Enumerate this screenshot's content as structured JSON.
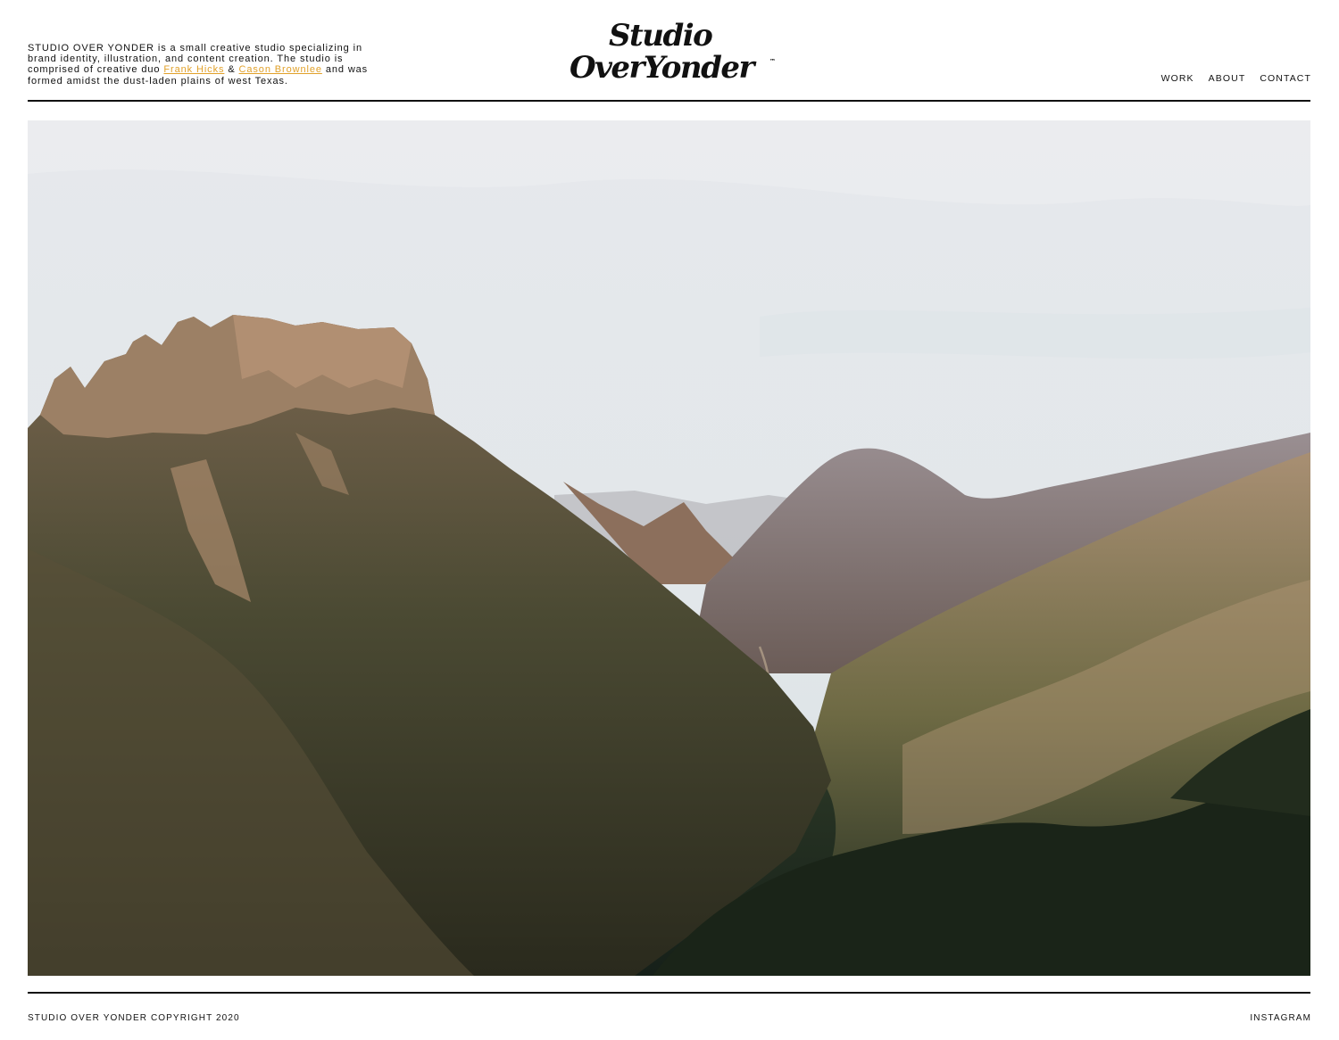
{
  "intro": {
    "text_before": "STUDIO OVER YONDER is a small creative studio specializing in brand identity, illustration, and content creation. The studio is comprised of creative duo ",
    "person_1": "Frank Hicks",
    "conjunction": " & ",
    "person_2": "Cason Brownlee",
    "text_after": " and was formed amidst the dust-laden plains of west Texas."
  },
  "logo": {
    "line_1": "Studio",
    "line_2": "OverYonder",
    "trademark": "™"
  },
  "nav": {
    "items": [
      "WORK",
      "ABOUT",
      "CONTACT"
    ]
  },
  "footer": {
    "copyright": "STUDIO OVER YONDER COPYRIGHT 2020",
    "social": "INSTAGRAM"
  },
  "colors": {
    "link": "#e1a12a",
    "rule": "#111111",
    "sky": "#e3e6ea"
  }
}
